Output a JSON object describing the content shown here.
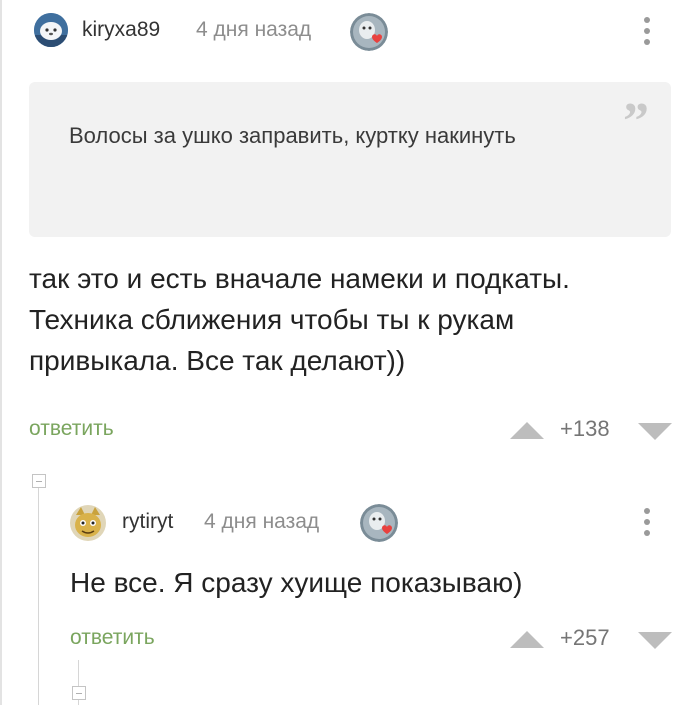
{
  "comments": [
    {
      "username": "kiryxa89",
      "timestamp": "4 дня назад",
      "quote": "Волосы за ушко заправить, куртку накинуть",
      "text": "так это и есть вначале намеки и подкаты. Техника сближения чтобы ты к рукам привыкала. Все так делают))",
      "reply_label": "ответить",
      "rating": "+138"
    },
    {
      "username": "rytiryt",
      "timestamp": "4 дня назад",
      "text": "Не все. Я сразу хуище показываю)",
      "reply_label": "ответить",
      "rating": "+257"
    }
  ],
  "icons": {
    "quote": "quote-icon",
    "more": "more-vertical-icon",
    "upvote": "upvote-icon",
    "downvote": "downvote-icon",
    "collapse": "collapse-thread-icon",
    "badge": "heart-badge-icon"
  },
  "colors": {
    "reply_link": "#7aa55e",
    "badge_heart": "#e8413e",
    "quote_bg": "#f2f2f2"
  }
}
